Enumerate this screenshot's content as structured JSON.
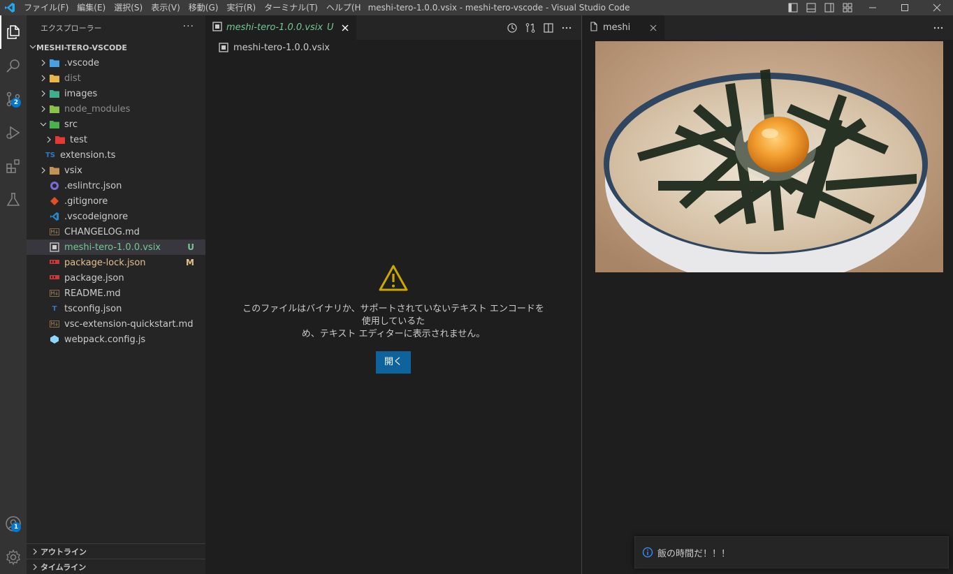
{
  "titlebar": {
    "menus": [
      "ファイル(F)",
      "編集(E)",
      "選択(S)",
      "表示(V)",
      "移動(G)",
      "実行(R)",
      "ターミナル(T)",
      "ヘルプ(H"
    ],
    "window_title": "meshi-tero-1.0.0.vsix - meshi-tero-vscode - Visual Studio Code"
  },
  "activity": {
    "source_control_badge": "2",
    "accounts_badge": "1"
  },
  "sidebar": {
    "title": "エクスプローラー",
    "more": "···",
    "root": "MESHI-TERO-VSCODE",
    "items": [
      {
        "label": ".vscode",
        "kind": "folder",
        "icon": "vscode-folder-icon",
        "color": "#4a9fe0"
      },
      {
        "label": "dist",
        "kind": "folder",
        "icon": "dist-folder-icon",
        "color": "#e8b64a"
      },
      {
        "label": "images",
        "kind": "folder",
        "icon": "images-folder-icon",
        "color": "#3fb08c"
      },
      {
        "label": "node_modules",
        "kind": "folder",
        "icon": "node-modules-folder-icon",
        "color": "#8bc34a"
      },
      {
        "label": "src",
        "kind": "folder-open",
        "icon": "src-folder-icon",
        "color": "#4caf50"
      },
      {
        "label": "test",
        "kind": "folder",
        "icon": "test-folder-icon",
        "color": "#e53935"
      },
      {
        "label": "extension.ts",
        "kind": "file",
        "icon": "typescript-icon",
        "color": "#3178c6"
      },
      {
        "label": "vsix",
        "kind": "folder",
        "icon": "folder-icon",
        "color": "#c09553"
      },
      {
        "label": ".eslintrc.json",
        "kind": "file",
        "icon": "eslint-icon",
        "color": "#7c6ad6"
      },
      {
        "label": ".gitignore",
        "kind": "file",
        "icon": "git-icon",
        "color": "#e44d26"
      },
      {
        "label": ".vscodeignore",
        "kind": "file",
        "icon": "vscode-icon",
        "color": "#2489ca"
      },
      {
        "label": "CHANGELOG.md",
        "kind": "file",
        "icon": "markdown-icon",
        "color": "#8a6e4a"
      },
      {
        "label": "meshi-tero-1.0.0.vsix",
        "kind": "file",
        "icon": "vsix-file-icon",
        "color": "#cccccc",
        "git": "U"
      },
      {
        "label": "package-lock.json",
        "kind": "file",
        "icon": "npm-icon",
        "color": "#cb3837",
        "git": "M"
      },
      {
        "label": "package.json",
        "kind": "file",
        "icon": "npm-icon",
        "color": "#cb3837"
      },
      {
        "label": "README.md",
        "kind": "file",
        "icon": "markdown-icon",
        "color": "#8a6e4a"
      },
      {
        "label": "tsconfig.json",
        "kind": "file",
        "icon": "tsconfig-icon",
        "color": "#3178c6"
      },
      {
        "label": "vsc-extension-quickstart.md",
        "kind": "file",
        "icon": "markdown-icon",
        "color": "#8a6e4a"
      },
      {
        "label": "webpack.config.js",
        "kind": "file",
        "icon": "webpack-icon",
        "color": "#8ed6fb"
      }
    ],
    "outline": "アウトライン",
    "timeline": "タイムライン"
  },
  "editor1": {
    "tab_label": "meshi-tero-1.0.0.vsix",
    "tab_git": "U",
    "breadcrumb": "meshi-tero-1.0.0.vsix",
    "message_line1": "このファイルはバイナリか、サポートされていないテキスト エンコードを使用しているた",
    "message_line2": "め、テキスト エディターに表示されません。",
    "open_button": "開く"
  },
  "editor2": {
    "tab_label": "meshi",
    "more": "···"
  },
  "notification": {
    "text": "飯の時間だ！！！"
  }
}
